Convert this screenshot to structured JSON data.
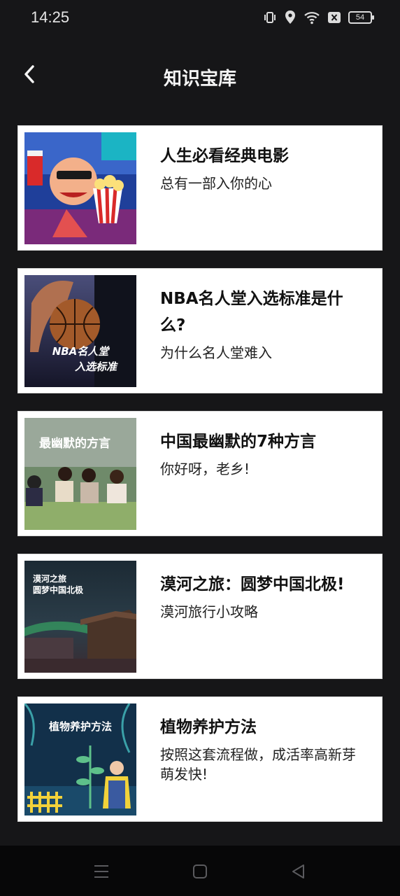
{
  "status_bar": {
    "time": "14:25",
    "battery": "54",
    "icons": [
      "vibrate-icon",
      "location-icon",
      "wifi-icon",
      "close-box-icon",
      "battery-icon"
    ]
  },
  "header": {
    "title": "知识宝库",
    "back_icon": "chevron-left-icon"
  },
  "articles": [
    {
      "title": "人生必看经典电影",
      "subtitle": "总有一部入你的心",
      "thumb_caption": ""
    },
    {
      "title": "NBA名人堂入选标准是什么?",
      "subtitle": "为什么名人堂难入",
      "thumb_caption": "NBA名人堂入选标准"
    },
    {
      "title": "中国最幽默的7种方言",
      "subtitle": "你好呀，老乡!",
      "thumb_caption": "最幽默的方言"
    },
    {
      "title": "漠河之旅：圆梦中国北极!",
      "subtitle": "漠河旅行小攻略",
      "thumb_caption": "漠河之旅 圆梦中国北极"
    },
    {
      "title": "植物养护方法",
      "subtitle": "按照这套流程做，成活率高新芽萌发快!",
      "thumb_caption": "植物养护方法"
    }
  ],
  "thumb_text": {
    "nba_line1": "NBA名人堂",
    "nba_line2": "入选标准",
    "dialect": "最幽默的方言",
    "mohe_line1": "漠河之旅",
    "mohe_line2": "圆梦中国北极",
    "plant": "植物养护方法"
  },
  "nav_bar": {
    "icons": [
      "menu-icon",
      "home-square-icon",
      "back-triangle-icon"
    ]
  }
}
